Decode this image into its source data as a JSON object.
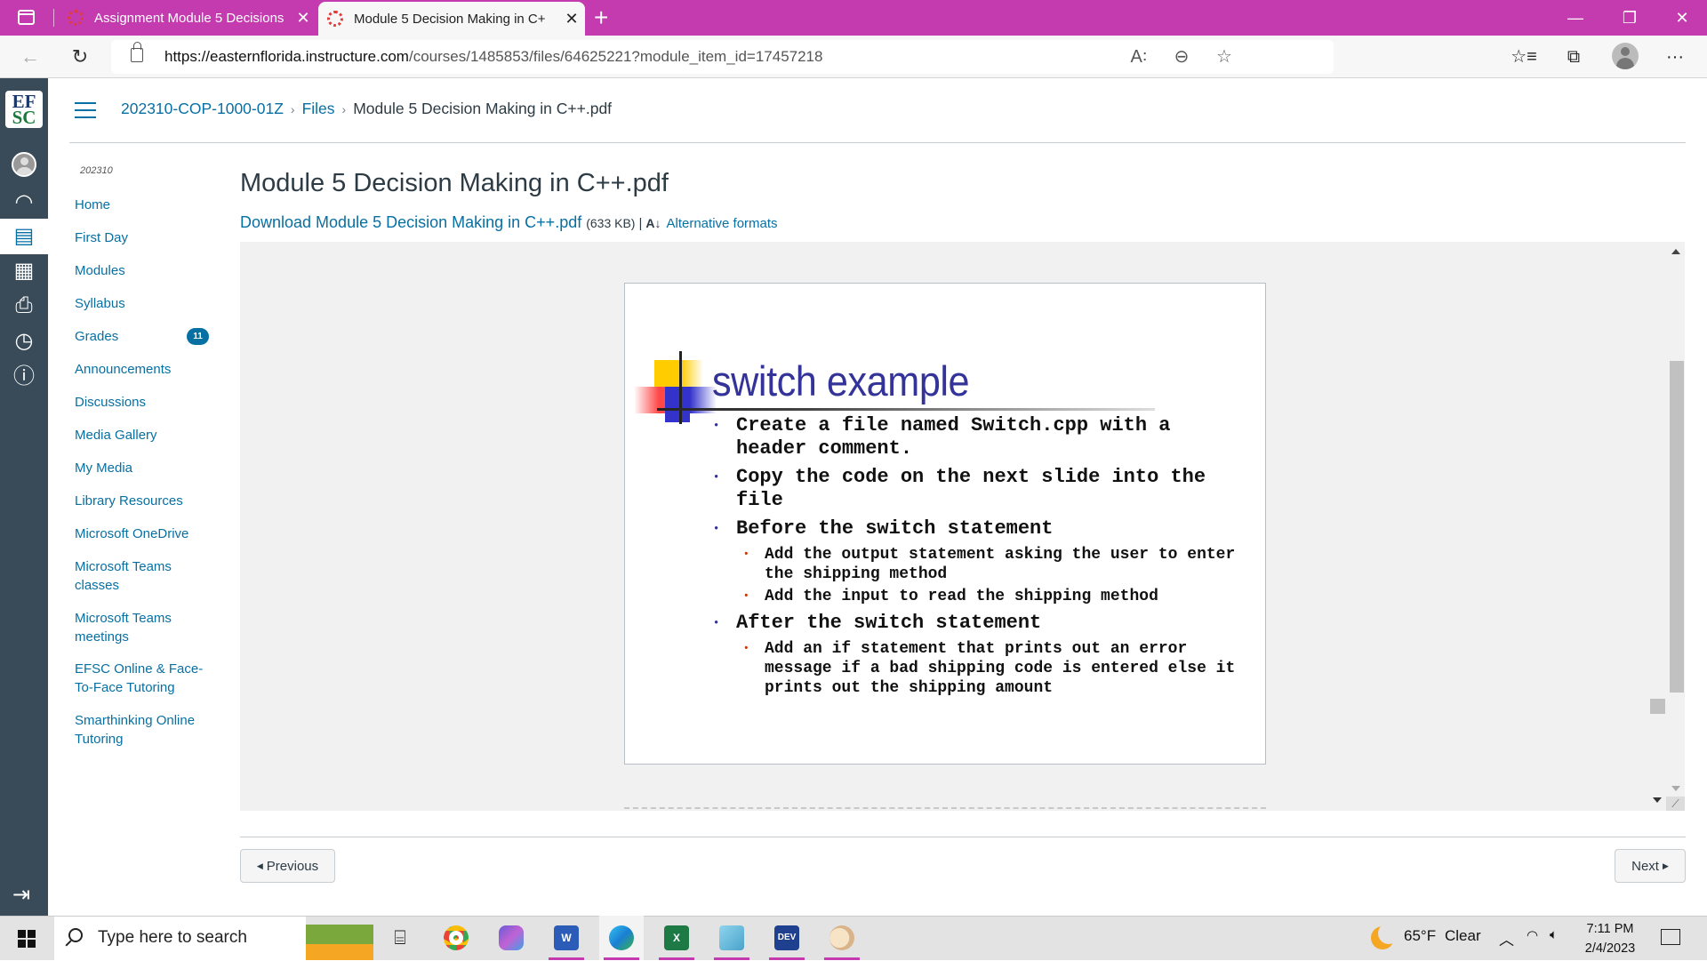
{
  "browser": {
    "tabs": [
      {
        "title": "Assignment Module 5 Decisions",
        "active": false
      },
      {
        "title": "Module 5 Decision Making in C++.pdf",
        "display_title": "Module 5 Decision Making in C+",
        "active": true
      }
    ],
    "url_host": "https://easternflorida.instructure.com",
    "url_path": "/courses/1485853/files/64625221?module_item_id=17457218",
    "icons": [
      "back-icon",
      "refresh-icon",
      "lock-icon",
      "read-aloud-icon",
      "zoom-out-icon",
      "add-favorite-icon",
      "favorites-icon",
      "collections-icon",
      "profile-icon",
      "more-icon",
      "minimize-icon",
      "restore-icon",
      "close-icon"
    ]
  },
  "global_nav": {
    "logo_top": "EF",
    "logo_bottom": "SC",
    "items": [
      "Account",
      "Dashboard",
      "Courses",
      "Calendar",
      "Inbox",
      "History",
      "Help"
    ],
    "active": "Courses"
  },
  "breadcrumb": [
    {
      "label": "202310-COP-1000-01Z",
      "link": true
    },
    {
      "label": "Files",
      "link": true
    },
    {
      "label": "Module 5 Decision Making in C++.pdf",
      "link": false
    }
  ],
  "course_nav": {
    "term": "202310",
    "items": [
      {
        "label": "Home"
      },
      {
        "label": "First Day"
      },
      {
        "label": "Modules"
      },
      {
        "label": "Syllabus"
      },
      {
        "label": "Grades",
        "badge": "11"
      },
      {
        "label": "Announcements"
      },
      {
        "label": "Discussions"
      },
      {
        "label": "Media Gallery"
      },
      {
        "label": "My Media"
      },
      {
        "label": "Library Resources"
      },
      {
        "label": "Microsoft OneDrive"
      },
      {
        "label": "Microsoft Teams classes"
      },
      {
        "label": "Microsoft Teams meetings"
      },
      {
        "label": "EFSC Online & Face-To-Face Tutoring"
      },
      {
        "label": "Smarthinking Online Tutoring"
      }
    ]
  },
  "file": {
    "title": "Module 5 Decision Making in C++.pdf",
    "download_label": "Download Module 5 Decision Making in C++.pdf",
    "size": "(633 KB)",
    "separator": "|",
    "alt_formats_label": "Alternative formats"
  },
  "slide": {
    "title": "switch example",
    "bullets": [
      {
        "text": "Create a file named Switch.cpp with a header comment."
      },
      {
        "text": "Copy the code on the next slide into the file"
      },
      {
        "text": "Before the switch statement",
        "sub": [
          "Add the output statement asking the user to enter the shipping method",
          "Add the input to read the shipping method"
        ]
      },
      {
        "text": "After the switch statement",
        "sub": [
          "Add an if statement that prints out an error message if a bad shipping code is entered else it prints out the shipping amount"
        ]
      }
    ]
  },
  "pager": {
    "previous_label": "Previous",
    "next_label": "Next"
  },
  "taskbar": {
    "search_placeholder": "Type here to search",
    "apps": [
      "Task View",
      "Google Chrome",
      "Microsoft 365",
      "Word",
      "Microsoft Edge",
      "Excel",
      "Notepad",
      "Dev-C++",
      "Paint"
    ],
    "weather_temp": "65°F",
    "weather_desc": "Clear",
    "time": "7:11 PM",
    "date": "2/4/2023"
  },
  "colors": {
    "browser_accent": "#c43aaf",
    "canvas_link": "#0770a3",
    "global_nav_bg": "#394b58",
    "slide_title": "#333399"
  }
}
